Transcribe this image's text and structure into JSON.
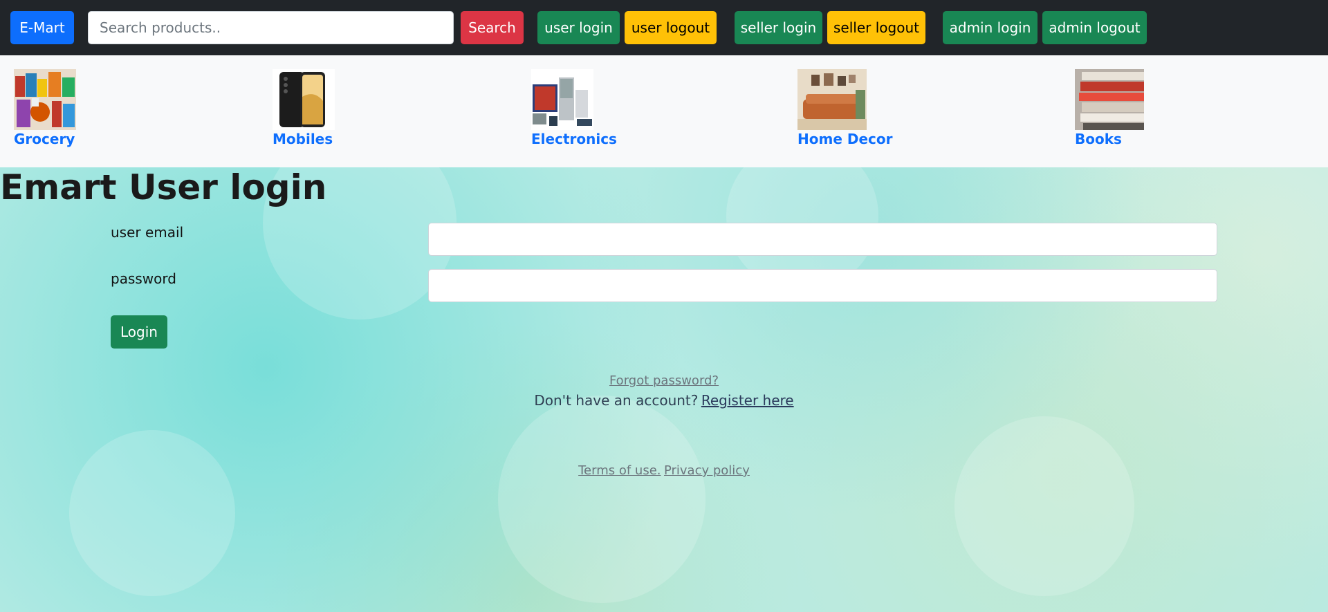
{
  "navbar": {
    "brand": "E-Mart",
    "search_placeholder": "Search products..",
    "search_button": "Search",
    "user_login": "user login",
    "user_logout": "user logout",
    "seller_login": "seller login",
    "seller_logout": "seller logout",
    "admin_login": "admin login",
    "admin_logout": "admin logout"
  },
  "categories": [
    {
      "label": "Grocery",
      "icon": "grocery-image"
    },
    {
      "label": "Mobiles",
      "icon": "mobile-phone-image"
    },
    {
      "label": "Electronics",
      "icon": "electronics-image"
    },
    {
      "label": "Home Decor",
      "icon": "home-decor-image"
    },
    {
      "label": "Books",
      "icon": "books-image"
    }
  ],
  "login": {
    "title": "Emart User login",
    "email_label": "user email",
    "password_label": "password",
    "login_button": "Login",
    "forgot_password": "Forgot password?",
    "no_account_text": "Don't have an account?",
    "register_link": "Register here",
    "terms": "Terms of use.",
    "privacy": "Privacy policy"
  },
  "colors": {
    "primary": "#0d6efd",
    "danger": "#dc3545",
    "success": "#198754",
    "warning": "#ffc107",
    "navbar": "#212529"
  }
}
